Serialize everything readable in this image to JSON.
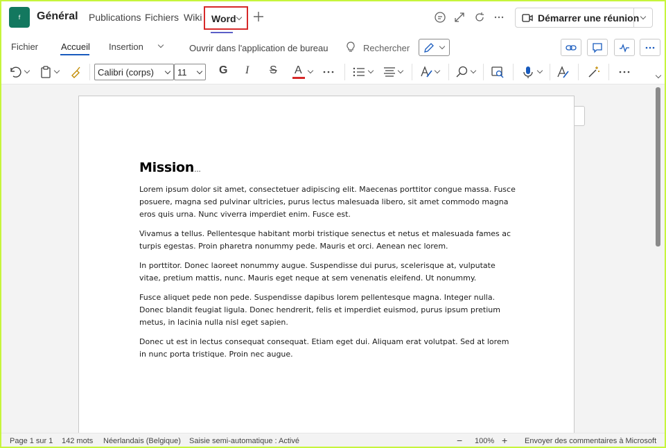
{
  "header": {
    "team_initial": "f",
    "channel_name": "Général",
    "tabs": [
      "Publications",
      "Fichiers",
      "Wiki"
    ],
    "active_tab": "Word",
    "meeting_button": "Démarrer une réunion"
  },
  "ribbon": {
    "tabs": [
      "Fichier",
      "Accueil",
      "Insertion"
    ],
    "open_desktop": "Ouvrir dans l'application de bureau",
    "search": "Rechercher"
  },
  "toolbar": {
    "font": "Calibri (corps)",
    "size": "11",
    "bold": "G",
    "italic": "I",
    "strike": "S",
    "font_color_letter": "A",
    "font_color": "#d62828"
  },
  "document": {
    "heading": "Mission",
    "paragraphs": [
      "Lorem ipsum dolor sit amet, consectetuer adipiscing elit. Maecenas porttitor congue massa. Fusce posuere, magna sed pulvinar ultricies, purus lectus malesuada libero, sit amet commodo magna eros quis urna. Nunc viverra imperdiet enim. Fusce est.",
      "Vivamus a tellus. Pellentesque habitant morbi tristique senectus et netus et malesuada fames ac turpis egestas. Proin pharetra nonummy pede. Mauris et orci. Aenean nec lorem.",
      "In porttitor. Donec laoreet nonummy augue. Suspendisse dui purus, scelerisque at, vulputate vitae, pretium mattis, nunc. Mauris eget neque at sem venenatis eleifend. Ut nonummy.",
      "Fusce aliquet pede non pede. Suspendisse dapibus lorem pellentesque magna. Integer nulla. Donec blandit feugiat ligula. Donec hendrerit, felis et imperdiet euismod, purus ipsum pretium metus, in lacinia nulla nisl eget sapien.",
      "Donec ut est in lectus consequat consequat. Etiam eget dui. Aliquam erat volutpat. Sed at lorem in nunc porta tristique. Proin nec augue."
    ]
  },
  "status": {
    "page": "Page 1 sur 1",
    "words": "142 mots",
    "language": "Néerlandais (Belgique)",
    "autosave": "Saisie semi-automatique : Activé",
    "zoom": "100%",
    "feedback": "Envoyer des commentaires à Microsoft"
  },
  "colors": {
    "accent": "#5b5fc7",
    "word_blue": "#185abd",
    "team_avatar": "#13785f",
    "highlight_box": "#d62828",
    "frame_border": "#c6f53b"
  }
}
